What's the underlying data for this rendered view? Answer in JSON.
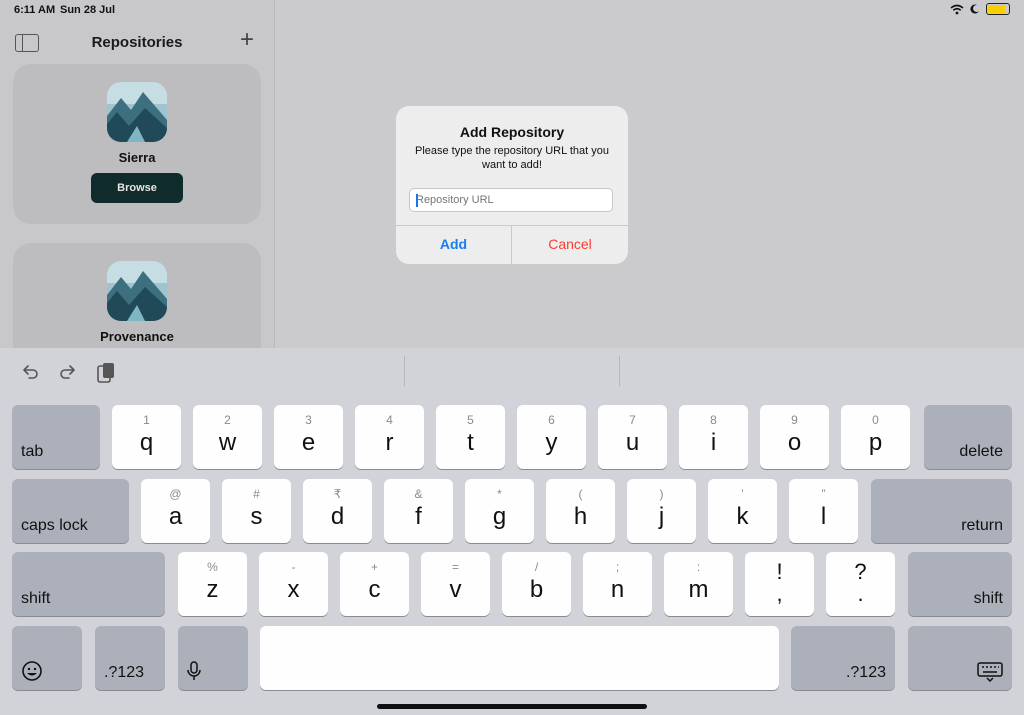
{
  "status_bar": {
    "time": "6:11 AM",
    "date": "Sun 28 Jul"
  },
  "sidebar": {
    "title": "Repositories",
    "repos": [
      {
        "name": "Sierra",
        "button": "Browse"
      },
      {
        "name": "Provenance"
      }
    ]
  },
  "alert": {
    "title": "Add Repository",
    "message": "Please type the repository URL that you want to add!",
    "input_placeholder": "Repository URL",
    "input_value": "",
    "add_label": "Add",
    "cancel_label": "Cancel"
  },
  "keyboard": {
    "row1": [
      {
        "sec": "1",
        "pri": "q"
      },
      {
        "sec": "2",
        "pri": "w"
      },
      {
        "sec": "3",
        "pri": "e"
      },
      {
        "sec": "4",
        "pri": "r"
      },
      {
        "sec": "5",
        "pri": "t"
      },
      {
        "sec": "6",
        "pri": "y"
      },
      {
        "sec": "7",
        "pri": "u"
      },
      {
        "sec": "8",
        "pri": "i"
      },
      {
        "sec": "9",
        "pri": "o"
      },
      {
        "sec": "0",
        "pri": "p"
      }
    ],
    "row2": [
      {
        "sec": "@",
        "pri": "a"
      },
      {
        "sec": "#",
        "pri": "s"
      },
      {
        "sec": "₹",
        "pri": "d"
      },
      {
        "sec": "&",
        "pri": "f"
      },
      {
        "sec": "*",
        "pri": "g"
      },
      {
        "sec": "(",
        "pri": "h"
      },
      {
        "sec": ")",
        "pri": "j"
      },
      {
        "sec": "’",
        "pri": "k"
      },
      {
        "sec": "”",
        "pri": "l"
      }
    ],
    "row3": [
      {
        "sec": "%",
        "pri": "z"
      },
      {
        "sec": "-",
        "pri": "x"
      },
      {
        "sec": "+",
        "pri": "c"
      },
      {
        "sec": "=",
        "pri": "v"
      },
      {
        "sec": "/",
        "pri": "b"
      },
      {
        "sec": ";",
        "pri": "n"
      },
      {
        "sec": ":",
        "pri": "m"
      }
    ],
    "punct": [
      {
        "top": "!",
        "bottom": ","
      },
      {
        "top": "?",
        "bottom": "."
      }
    ],
    "tab_label": "tab",
    "delete_label": "delete",
    "caps_label": "caps lock",
    "return_label": "return",
    "shift_label": "shift",
    "numbers_label": ".?123"
  }
}
